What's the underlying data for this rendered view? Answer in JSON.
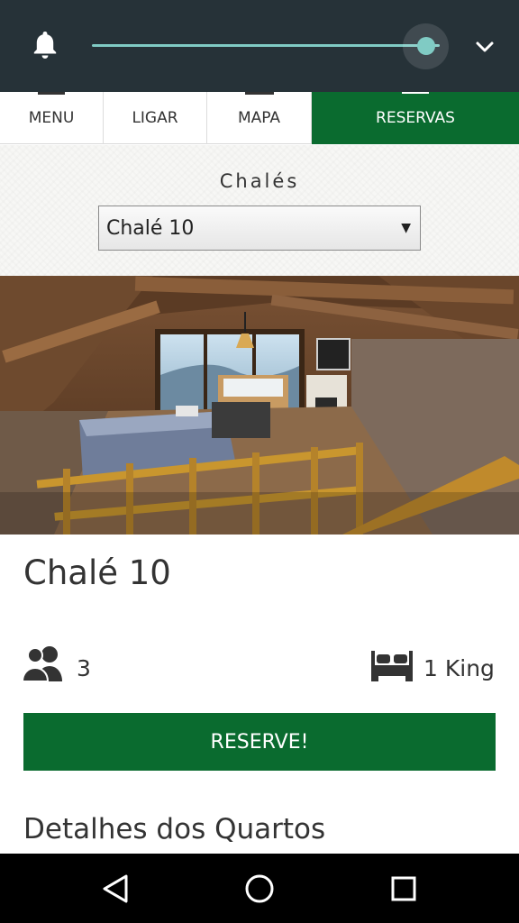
{
  "status_shade": {
    "brightness_level": 0.96,
    "icons": [
      "bell-icon",
      "expand-chevron-icon"
    ]
  },
  "tabs": [
    {
      "label": "MENU",
      "active": false
    },
    {
      "label": "LIGAR",
      "active": false
    },
    {
      "label": "MAPA",
      "active": false
    },
    {
      "label": "RESERVAS",
      "active": true
    }
  ],
  "chalet_select": {
    "label": "Chalés",
    "selected": "Chalé 10"
  },
  "chalet": {
    "title": "Chalé 10",
    "guests": "3",
    "bed": "1 King",
    "reserve_label": "RESERVE!",
    "details_heading": "Detalhes dos Quartos"
  },
  "colors": {
    "brand_green": "#0a6b2f",
    "shade_bg": "#263238",
    "slider_teal": "#80cbc4"
  },
  "system_nav": {
    "icons": [
      "back-icon",
      "home-icon",
      "recents-icon"
    ]
  }
}
